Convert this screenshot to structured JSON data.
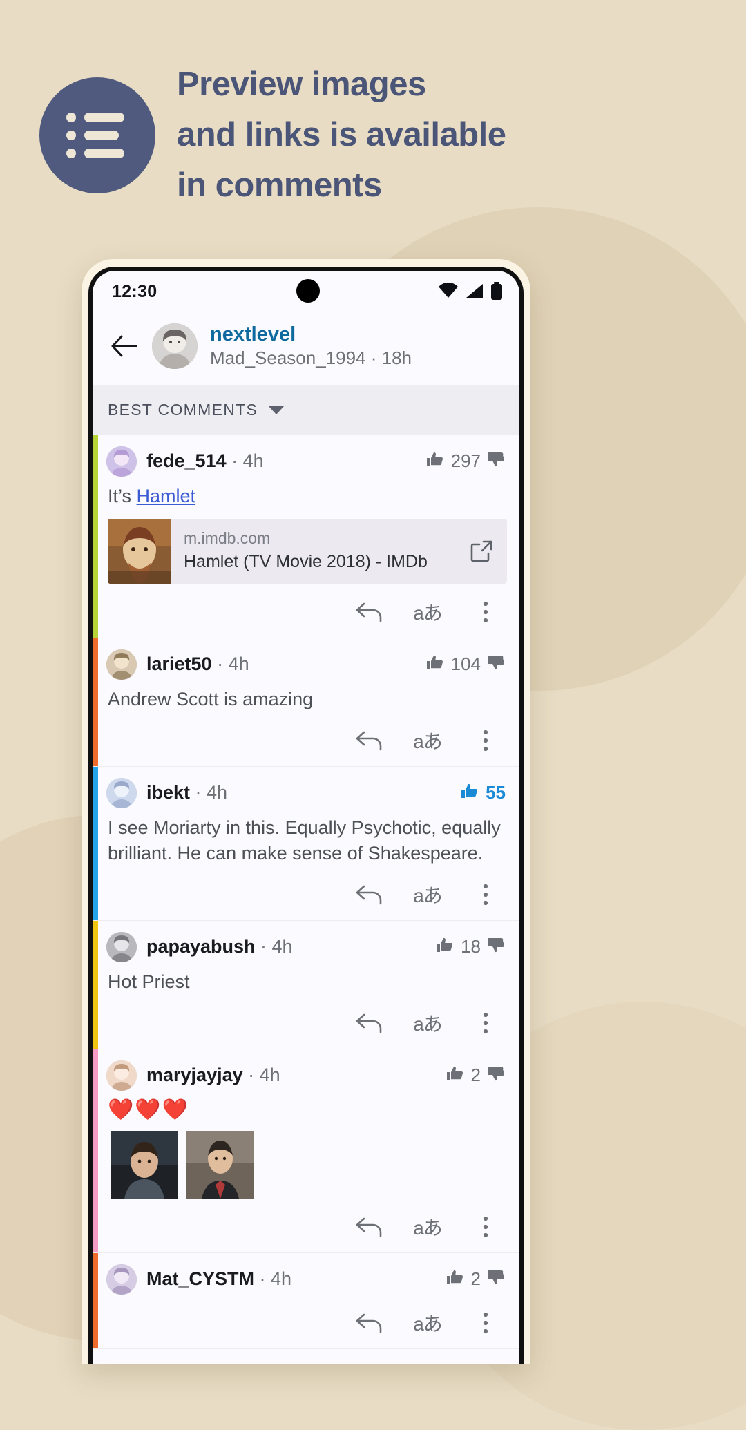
{
  "promo": {
    "icon": "list-bullet-icon",
    "badge_color": "#4f5a7e",
    "headline_lines": [
      "Preview images",
      "and links is available",
      "in comments"
    ],
    "text_color": "#4a5578"
  },
  "page_background": "#e8dcc4",
  "phone": {
    "status_bar": {
      "time": "12:30",
      "icons": [
        "wifi-icon",
        "signal-icon",
        "battery-icon"
      ]
    },
    "post_header": {
      "back_icon": "back-arrow-icon",
      "avatar": "post-author-avatar",
      "username": "nextlevel",
      "username_color": "#0e6a9e",
      "subtitle": "Mad_Season_1994 · 18h"
    },
    "sort_bar": {
      "label": "BEST COMMENTS",
      "caret_icon": "chevron-down-icon"
    },
    "actions": {
      "reply_icon": "reply-arrow-icon",
      "translate_label": "aあ",
      "more_icon": "more-vertical-icon",
      "upvote_icon": "thumbs-up-icon",
      "downvote_icon": "thumbs-down-icon"
    },
    "comments": [
      {
        "rail_color": "#b5d334",
        "username": "fede_514",
        "age": "· 4h",
        "votes": "297",
        "voted": false,
        "body_prefix": "It’s ",
        "body_link": "Hamlet",
        "body_suffix": "",
        "link_preview": {
          "domain": "m.imdb.com",
          "title": "Hamlet (TV Movie 2018) - IMDb",
          "open_icon": "open-external-icon",
          "thumb": "hamlet-poster-thumb"
        }
      },
      {
        "rail_color": "#ef6c2c",
        "username": "lariet50",
        "age": "· 4h",
        "votes": "104",
        "voted": false,
        "body_prefix": "Andrew Scott is amazing",
        "body_link": "",
        "body_suffix": ""
      },
      {
        "rail_color": "#23a3e8",
        "username": "ibekt",
        "age": "· 4h",
        "votes": "55",
        "voted": true,
        "body_prefix": "I see Moriarty in this. Equally Psychotic, equally brilliant. He can make sense of Shakespeare.",
        "body_link": "",
        "body_suffix": ""
      },
      {
        "rail_color": "#f0c413",
        "username": "papayabush",
        "age": "· 4h",
        "votes": "18",
        "voted": false,
        "body_prefix": "Hot Priest",
        "body_link": "",
        "body_suffix": ""
      },
      {
        "rail_color": "#f59bc4",
        "username": "maryjayjay",
        "age": "· 4h",
        "votes": "2",
        "voted": false,
        "body_prefix": "",
        "body_link": "",
        "body_suffix": "",
        "emoji": "❤️❤️❤️",
        "images": [
          "comment-photo-1",
          "comment-photo-2"
        ]
      },
      {
        "rail_color": "#ef6c2c",
        "username": "Mat_CYSTM",
        "age": "· 4h",
        "votes": "2",
        "voted": false,
        "body_prefix": "",
        "body_link": "",
        "body_suffix": ""
      }
    ]
  }
}
